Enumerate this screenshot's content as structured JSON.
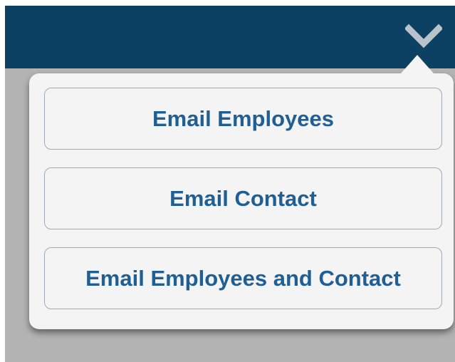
{
  "header": {
    "toggle_icon": "chevron-down-icon"
  },
  "menu": {
    "items": [
      {
        "label": "Email Employees"
      },
      {
        "label": "Email Contact"
      },
      {
        "label": "Email Employees and Contact"
      }
    ]
  },
  "colors": {
    "header_background": "#0c4163",
    "chevron": "#b9c3cb",
    "backdrop": "#b3b3b3",
    "popover_background": "#f4f4f4",
    "button_border": "#9eaab5",
    "button_text": "#1f5f93"
  }
}
